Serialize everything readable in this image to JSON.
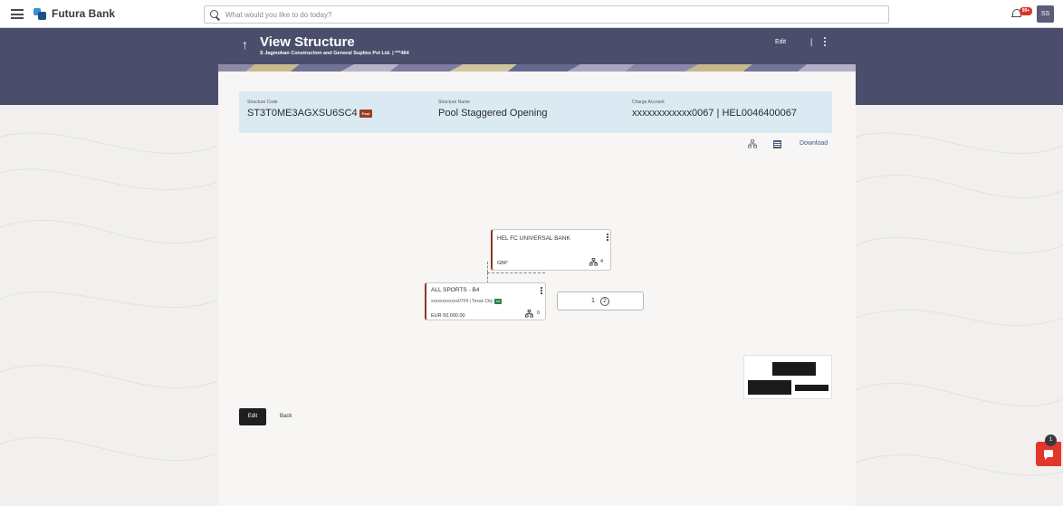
{
  "header": {
    "brand": "Futura Bank",
    "search_placeholder": "What would you like to do today?",
    "notifications_badge": "99+",
    "user_initials": "SS"
  },
  "hero": {
    "title": "View Structure",
    "subtitle": "S Jagmohan Construction and General Suplies Pvt Ltd. | ***464",
    "edit_label": "Edit",
    "separator": "|"
  },
  "structure": {
    "code_label": "Structure Code",
    "code_value": "ST3T0ME3AGXSU6SC4",
    "type_tag": "Pool",
    "name_label": "Structure Name",
    "name_value": "Pool Staggered Opening",
    "charge_label": "Charge Account",
    "charge_value": "xxxxxxxxxxxx0067 | HEL0046400067"
  },
  "toolbar": {
    "download_label": "Download"
  },
  "tree": {
    "root": {
      "name": "HEL FC UNIVERSAL BANK",
      "currency": "GBP",
      "child_count": "4"
    },
    "child": {
      "name": "ALL SPORTS - B4",
      "account": "xxxxxxxxxxxx0704 | Texas City",
      "tag": "Int",
      "amount": "EUR 50,000.00",
      "child_count": "0"
    },
    "pagination": {
      "current": "1",
      "next": "2"
    }
  },
  "actions": {
    "edit_label": "Edit",
    "back_label": "Back"
  },
  "chat": {
    "badge": "1"
  },
  "colors": {
    "hero": "#4a4d6b",
    "accent_brown": "#8a3a24",
    "int_green": "#2e7d4a",
    "info_panel": "#dbe9f3",
    "chat_red": "#e0362c"
  }
}
